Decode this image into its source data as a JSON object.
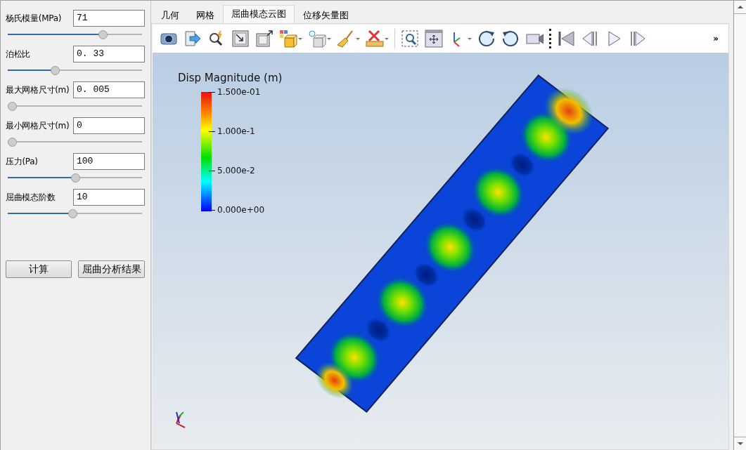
{
  "parameters": [
    {
      "label": "杨氏模量(MPa)",
      "value": "71",
      "level": 0.72
    },
    {
      "label": "泊松比",
      "value": "0. 33",
      "level": 0.34
    },
    {
      "label": "最大网格尺寸(m)",
      "value": "0. 005",
      "level": 0
    },
    {
      "label": "最小网格尺寸(m)",
      "value": "0",
      "level": 0
    },
    {
      "label": "压力(Pa)",
      "value": "100",
      "level": 0.5
    },
    {
      "label": "屈曲模态阶数",
      "value": "10",
      "level": 0.48
    }
  ],
  "buttons": [
    "计算",
    "屈曲分析结果"
  ],
  "tabs": [
    {
      "label": "几何",
      "selected": false
    },
    {
      "label": "网格",
      "selected": false
    },
    {
      "label": "屈曲模态云图",
      "selected": true
    },
    {
      "label": "位移矢量图",
      "selected": false
    }
  ],
  "toolbar": {
    "overflow": "»"
  },
  "legend": {
    "title": "Disp Magnitude (m)",
    "ticks": [
      "1.500e-01",
      "1.000e-1",
      "5.000e-2",
      "0.000e+00"
    ]
  }
}
